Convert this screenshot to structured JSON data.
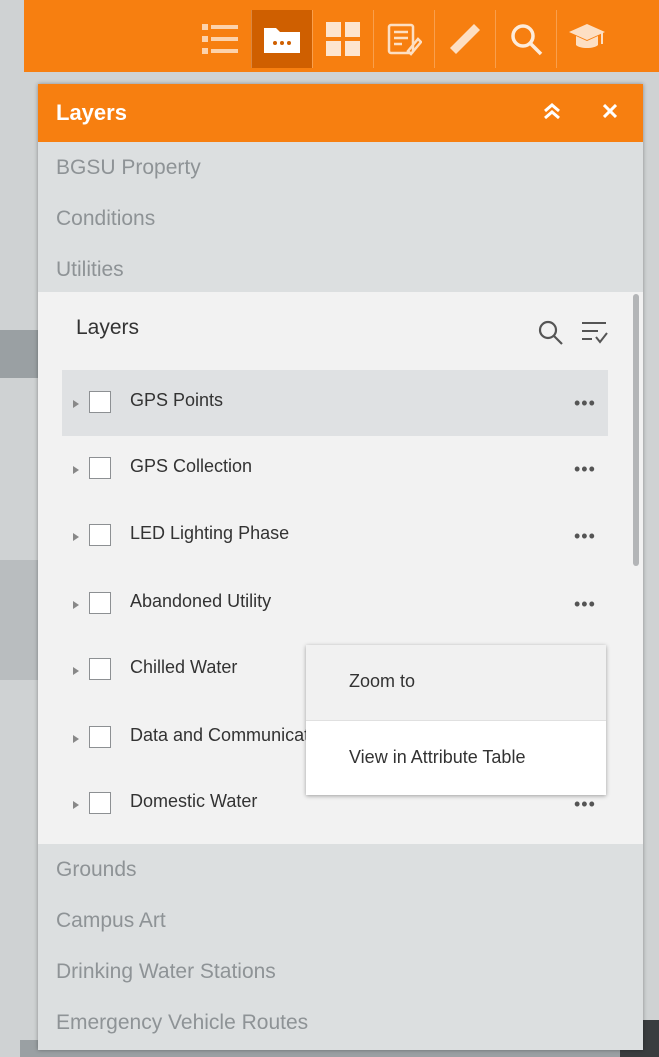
{
  "toolbar": {
    "tools": [
      {
        "icon": "layer-list-icon"
      },
      {
        "icon": "folder-more-icon",
        "active": true
      },
      {
        "icon": "grid-icon"
      },
      {
        "icon": "edit-icon"
      },
      {
        "icon": "measure-icon"
      },
      {
        "icon": "search-icon"
      },
      {
        "icon": "education-icon"
      }
    ],
    "accent_color": "#f77f10"
  },
  "panel": {
    "title": "Layers",
    "collapse_icon": "double-chevron-up-icon",
    "close_icon": "close-icon",
    "groups_top": [
      "BGSU Property",
      "Conditions",
      "Utilities"
    ],
    "groups_bottom": [
      "Grounds",
      "Campus Art",
      "Drinking Water Stations",
      "Emergency Vehicle Routes"
    ]
  },
  "layers_widget": {
    "title": "Layers",
    "rows": [
      {
        "name": "GPS Points",
        "more": "•••"
      },
      {
        "name": "GPS Collection",
        "more": "•••"
      },
      {
        "name": "LED Lighting Phase",
        "more": "•••"
      },
      {
        "name": "Abandoned Utility",
        "more": "•••"
      },
      {
        "name": "Chilled Water",
        "more": "•••"
      },
      {
        "name": "Data and Communications",
        "more": "•••"
      },
      {
        "name": "Domestic Water",
        "more": "•••"
      }
    ]
  },
  "context_menu": {
    "items": [
      "Zoom to",
      "View in Attribute Table"
    ]
  }
}
